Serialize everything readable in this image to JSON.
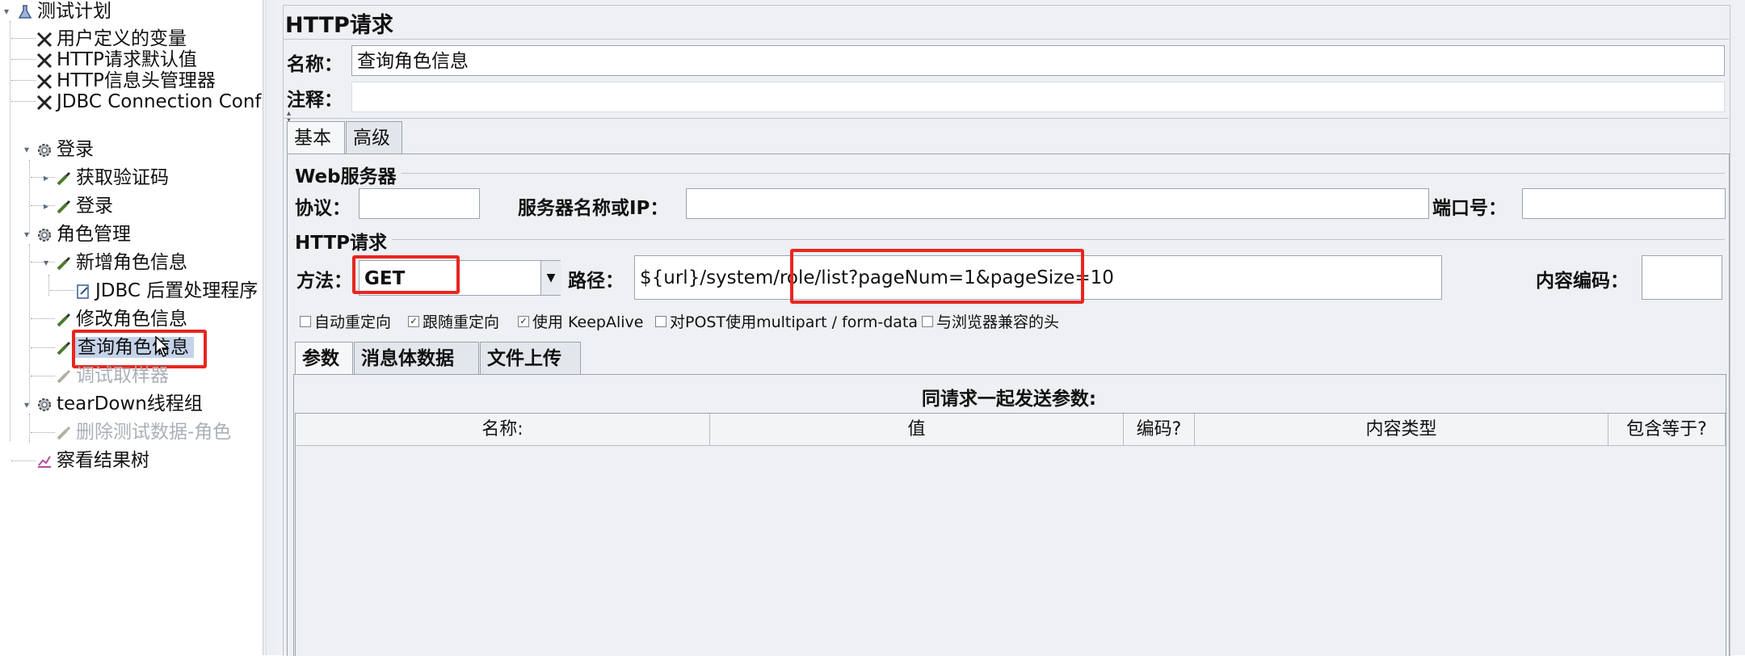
{
  "tree": {
    "root": "测试计划",
    "items": [
      {
        "label": "用户定义的变量",
        "icon": "wrench-icon"
      },
      {
        "label": "HTTP请求默认值",
        "icon": "wrench-icon"
      },
      {
        "label": "HTTP信息头管理器",
        "icon": "wrench-icon"
      },
      {
        "label": "JDBC Connection Conf",
        "icon": "wrench-icon"
      },
      {
        "label": "登录",
        "icon": "gear-icon"
      },
      {
        "label": "获取验证码",
        "icon": "pipette-icon"
      },
      {
        "label": "登录",
        "icon": "pipette-icon"
      },
      {
        "label": "角色管理",
        "icon": "gear-icon"
      },
      {
        "label": "新增角色信息",
        "icon": "pipette-icon"
      },
      {
        "label": "JDBC 后置处理程序",
        "icon": "document-icon"
      },
      {
        "label": "修改角色信息",
        "icon": "pipette-icon"
      },
      {
        "label": "查询角色信息",
        "icon": "pipette-icon"
      },
      {
        "label": "调试取样器",
        "icon": "pipette-icon"
      },
      {
        "label": "tearDown线程组",
        "icon": "gear-icon"
      },
      {
        "label": "删除测试数据-角色",
        "icon": "pipette-icon"
      },
      {
        "label": "察看结果树",
        "icon": "chart-icon"
      }
    ]
  },
  "panel": {
    "title": "HTTP请求",
    "name_label": "名称：",
    "name_value": "查询角色信息",
    "comment_label": "注释：",
    "comment_value": "",
    "tabs": [
      "基本",
      "高级"
    ],
    "web_server": {
      "group_title": "Web服务器",
      "protocol_label": "协议：",
      "protocol_value": "",
      "server_label": "服务器名称或IP：",
      "server_value": "",
      "port_label": "端口号：",
      "port_value": ""
    },
    "http_request": {
      "group_title": "HTTP请求",
      "method_label": "方法：",
      "method_value": "GET",
      "path_label": "路径：",
      "path_value": "${url}/system/role/list?pageNum=1&pageSize=10",
      "encoding_label": "内容编码：",
      "encoding_value": ""
    },
    "options": [
      {
        "label": "自动重定向",
        "checked": false
      },
      {
        "label": "跟随重定向",
        "checked": true
      },
      {
        "label": "使用 KeepAlive",
        "checked": true
      },
      {
        "label": "对POST使用multipart / form-data",
        "checked": false
      },
      {
        "label": "与浏览器兼容的头",
        "checked": false
      }
    ],
    "sub_tabs": [
      "参数",
      "消息体数据",
      "文件上传"
    ],
    "params_table": {
      "caption": "同请求一起发送参数:",
      "columns": [
        "名称:",
        "值",
        "编码?",
        "内容类型",
        "包含等于?"
      ]
    }
  },
  "colors": {
    "highlight_box": "#e8261f",
    "selection": "#c5d3ea",
    "panel_bg": "#eef0f3"
  }
}
